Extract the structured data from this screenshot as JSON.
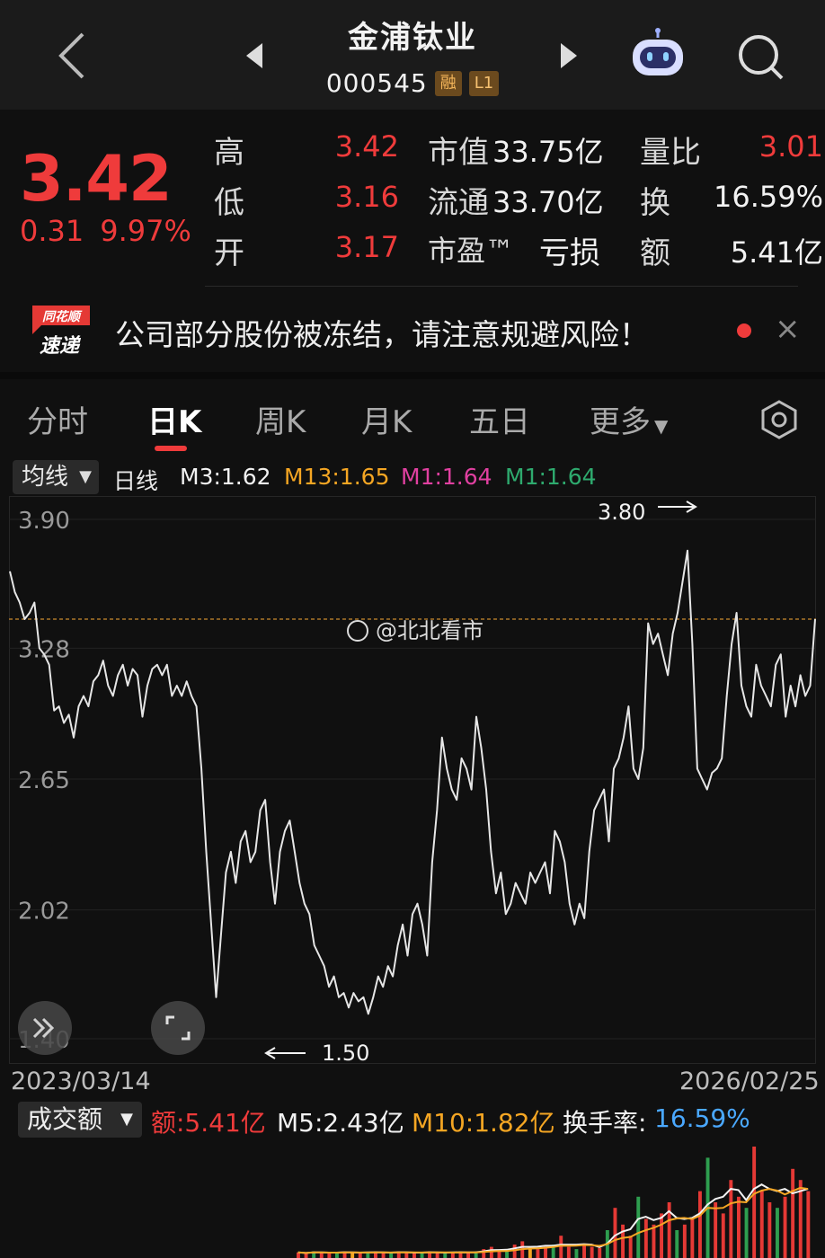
{
  "header": {
    "title": "金浦钛业",
    "code": "000545",
    "badges": [
      "融",
      "L1"
    ]
  },
  "quote": {
    "price": "3.42",
    "change": "0.31",
    "change_pct": "9.97%",
    "rows": [
      {
        "label": "高",
        "value": "3.42",
        "label2": "市值",
        "value2": "33.75亿",
        "label3": "量比",
        "value3": "3.01"
      },
      {
        "label": "低",
        "value": "3.16",
        "label2": "流通",
        "value2": "33.70亿",
        "label3": "换",
        "value3": "16.59%"
      },
      {
        "label": "开",
        "value": "3.17",
        "label2": "市盈™",
        "value2": "亏损",
        "label3": "额",
        "value3": "5.41亿"
      }
    ]
  },
  "notice": {
    "logo_top": "同花顺",
    "logo_bottom": "速递",
    "text": "公司部分股份被冻结，请注意规避风险！",
    "close": "×"
  },
  "tabs": [
    "分时",
    "日K",
    "周K",
    "月K",
    "五日",
    "更多"
  ],
  "active_tab": "日K",
  "ma_legend": {
    "select": "均线",
    "period": "日线",
    "items": [
      {
        "label": "M3:1.62",
        "color": "#f2f2f2"
      },
      {
        "label": "M13:1.65",
        "color": "#f5a623"
      },
      {
        "label": "M1:1.64",
        "color": "#e040a0"
      },
      {
        "label": "M1:1.64",
        "color": "#2eaa6e"
      }
    ]
  },
  "chart_data": {
    "type": "line",
    "y_ticks": [
      "3.90",
      "3.28",
      "2.65",
      "2.02",
      "1.40"
    ],
    "ylim": [
      1.4,
      3.9
    ],
    "reference_line": 3.42,
    "annotations": [
      {
        "text": "3.80",
        "value": 3.8
      },
      {
        "text": "1.50",
        "value": 1.5
      }
    ],
    "watermark": "@北北看市",
    "x_start": "2023/03/14",
    "x_end": "2026/02/25",
    "series": [
      {
        "values": [
          3.65,
          3.55,
          3.5,
          3.42,
          3.45,
          3.5,
          3.28,
          3.25,
          3.2,
          2.98,
          3.0,
          2.92,
          2.96,
          2.85,
          3.0,
          3.05,
          3.0,
          3.12,
          3.15,
          3.22,
          3.1,
          3.05,
          3.15,
          3.2,
          3.1,
          3.18,
          3.15,
          2.95,
          3.1,
          3.18,
          3.2,
          3.15,
          3.2,
          3.05,
          3.1,
          3.05,
          3.12,
          3.05,
          3.0,
          2.7,
          2.3,
          1.95,
          1.6,
          1.9,
          2.2,
          2.3,
          2.15,
          2.35,
          2.4,
          2.25,
          2.3,
          2.5,
          2.55,
          2.25,
          2.05,
          2.3,
          2.4,
          2.45,
          2.3,
          2.15,
          2.05,
          2.0,
          1.85,
          1.8,
          1.75,
          1.65,
          1.7,
          1.6,
          1.62,
          1.55,
          1.62,
          1.58,
          1.6,
          1.52,
          1.6,
          1.7,
          1.65,
          1.75,
          1.7,
          1.85,
          1.95,
          1.8,
          2.0,
          2.05,
          1.95,
          1.8,
          2.25,
          2.5,
          2.85,
          2.7,
          2.6,
          2.55,
          2.75,
          2.7,
          2.6,
          2.95,
          2.8,
          2.6,
          2.3,
          2.1,
          2.2,
          2.0,
          2.05,
          2.15,
          2.1,
          2.05,
          2.2,
          2.15,
          2.2,
          2.25,
          2.1,
          2.4,
          2.35,
          2.25,
          2.05,
          1.95,
          2.05,
          1.98,
          2.3,
          2.5,
          2.55,
          2.6,
          2.35,
          2.7,
          2.75,
          2.85,
          3.0,
          2.7,
          2.65,
          2.8,
          3.4,
          3.3,
          3.35,
          3.25,
          3.15,
          3.35,
          3.45,
          3.6,
          3.75,
          3.3,
          2.7,
          2.65,
          2.6,
          2.68,
          2.7,
          2.75,
          3.05,
          3.3,
          3.45,
          3.1,
          3.0,
          2.95,
          3.2,
          3.1,
          3.05,
          3.0,
          3.2,
          3.25,
          2.95,
          3.1,
          3.0,
          3.15,
          3.05,
          3.1,
          3.42
        ]
      }
    ]
  },
  "fullscreen_icon": "expand-icon",
  "dates": {
    "start": "2023/03/14",
    "end": "2026/02/25"
  },
  "volume_legend": {
    "select": "成交额",
    "items": [
      {
        "label": "额:5.41亿",
        "color": "#ef3b3b"
      },
      {
        "label": "M5:2.43亿",
        "color": "#f2f2f2"
      },
      {
        "label": "M10:1.82亿",
        "color": "#f5a623"
      },
      {
        "label": "换手率:",
        "color": "#f2f2f2"
      },
      {
        "label": "16.59%",
        "color": "#4aa8ff"
      }
    ]
  },
  "volume_data": {
    "values": [
      0.05,
      0.04,
      0.06,
      0.05,
      0.04,
      0.05,
      0.06,
      0.05,
      0.04,
      0.05,
      0.06,
      0.05,
      0.04,
      0.06,
      0.05,
      0.04,
      0.05,
      0.06,
      0.05,
      0.04,
      0.05,
      0.06,
      0.05,
      0.06,
      0.08,
      0.1,
      0.07,
      0.06,
      0.12,
      0.15,
      0.1,
      0.08,
      0.1,
      0.12,
      0.2,
      0.1,
      0.08,
      0.12,
      0.1,
      0.09,
      0.25,
      0.45,
      0.3,
      0.2,
      0.55,
      0.35,
      0.3,
      0.4,
      0.5,
      0.25,
      0.3,
      0.35,
      0.6,
      0.9,
      0.5,
      0.4,
      0.7,
      0.55,
      0.45,
      1.0,
      0.6,
      0.5,
      0.45,
      0.55,
      0.8,
      0.7,
      0.6
    ],
    "colors": [
      "red",
      "red",
      "green",
      "red",
      "red",
      "green",
      "red",
      "orange",
      "red",
      "green",
      "red",
      "red",
      "green",
      "red",
      "red",
      "red",
      "green",
      "red",
      "red",
      "green",
      "red",
      "red",
      "red",
      "green",
      "red",
      "red",
      "red",
      "green",
      "red",
      "red",
      "orange",
      "red",
      "red",
      "green",
      "red",
      "red",
      "green",
      "red",
      "red",
      "red",
      "green",
      "red",
      "red",
      "red",
      "green",
      "red",
      "red",
      "red",
      "red",
      "green",
      "red",
      "red",
      "red",
      "green",
      "red",
      "red",
      "red",
      "red",
      "green",
      "red",
      "red",
      "red",
      "green",
      "red",
      "red",
      "red",
      "red"
    ]
  }
}
